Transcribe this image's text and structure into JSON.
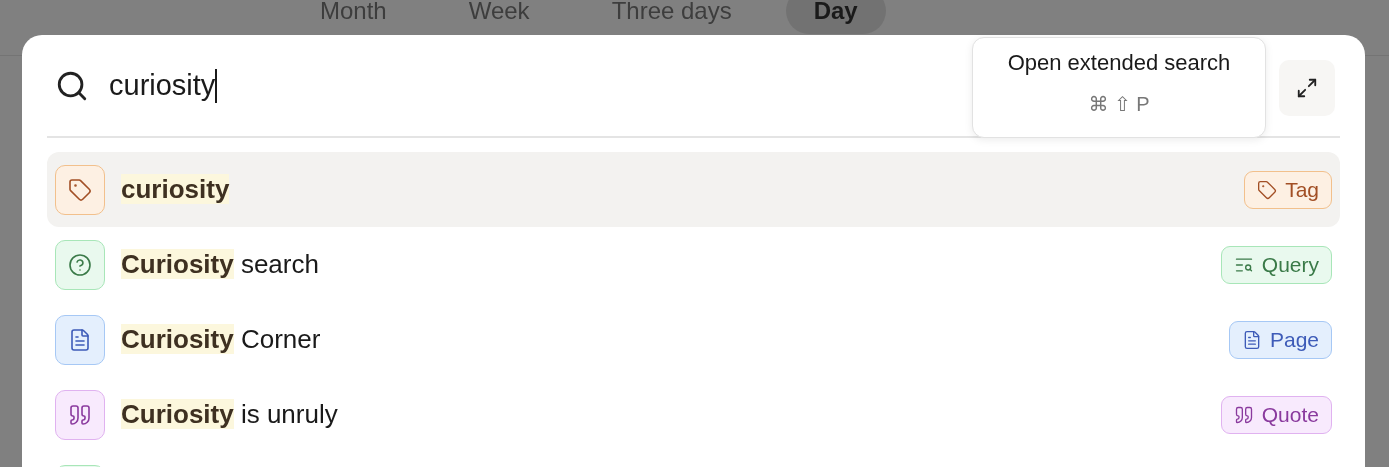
{
  "view_tabs": [
    {
      "label": "Month",
      "selected": false
    },
    {
      "label": "Week",
      "selected": false
    },
    {
      "label": "Three days",
      "selected": false
    },
    {
      "label": "Day",
      "selected": true
    }
  ],
  "search": {
    "value": "curiosity"
  },
  "tooltip": {
    "title": "Open extended search",
    "shortcut": "⌘ ⇧ P"
  },
  "results": [
    {
      "kind": "tag",
      "match": "curiosity",
      "badge": "Tag",
      "selected": true
    },
    {
      "kind": "query",
      "match": "Curiosity",
      "rest": " search",
      "badge": "Query",
      "selected": false
    },
    {
      "kind": "page",
      "match": "Curiosity",
      "rest": " Corner",
      "badge": "Page",
      "selected": false
    },
    {
      "kind": "quote",
      "match": "Curiosity",
      "rest": " is unruly",
      "badge": "Quote",
      "selected": false
    },
    {
      "kind": "query",
      "selected": false
    }
  ]
}
